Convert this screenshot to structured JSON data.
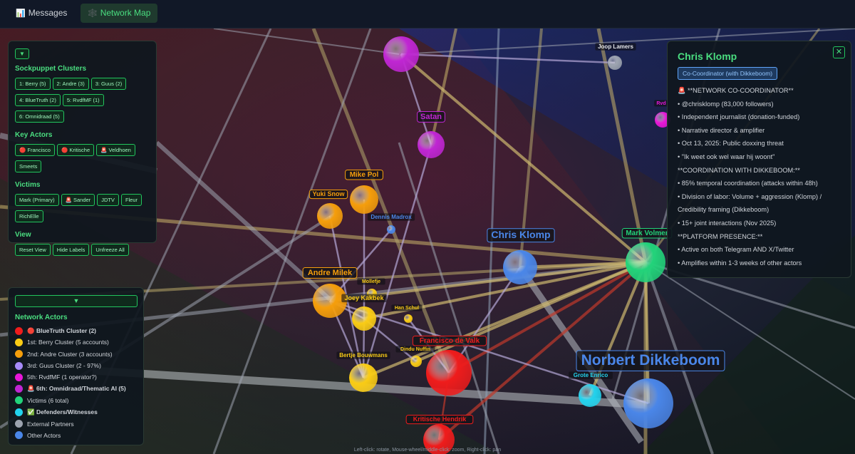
{
  "tabs": [
    {
      "icon": "📊",
      "label": "Messages",
      "active": false
    },
    {
      "icon": "🕸️",
      "label": "Network Map",
      "active": true
    }
  ],
  "controls": {
    "toggle": "▼",
    "sections": [
      {
        "title": "Sockpuppet Clusters",
        "chips": [
          "1: Berry (5)",
          "2: Andre (3)",
          "3: Guus (2)",
          "4: BlueTruth (2)",
          "5: RvdfMF (1)",
          "6: Omnidraad (5)"
        ]
      },
      {
        "title": "Key Actors",
        "chips": [
          "🔴 Francisco",
          "🔴 Kritische",
          "🚨 Veldhoen",
          "Smeets"
        ]
      },
      {
        "title": "Victims",
        "chips": [
          "Mark (Primary)",
          "🚨 Sander",
          "JDTV",
          "Fleur",
          "RichElle"
        ]
      },
      {
        "title": "View",
        "chips": [
          "Reset View",
          "Hide Labels",
          "Unfreeze All"
        ]
      }
    ]
  },
  "legend": {
    "toggle": "▼",
    "title": "Network Actors",
    "items": [
      {
        "label": "🔴 BlueTruth Cluster (2)",
        "color": "#ef1c1c",
        "bold": true
      },
      {
        "label": "1st: Berry Cluster (5 accounts)",
        "color": "#facc15",
        "bold": false
      },
      {
        "label": "2nd: Andre Cluster (3 accounts)",
        "color": "#f59e0b",
        "bold": false
      },
      {
        "label": "3rd: Guus Cluster (2 - 97%)",
        "color": "#a78bfa",
        "bold": false
      },
      {
        "label": "5th: RvdfMF (1 operator?)",
        "color": "#e817d8",
        "bold": false
      },
      {
        "label": "🚨 6th: Omnidraad/Thematic AI (5)",
        "color": "#c026d3",
        "bold": true
      },
      {
        "label": "Victims (6 total)",
        "color": "#22d37a",
        "bold": false
      },
      {
        "label": "✅ Defenders/Witnesses",
        "color": "#22d3ee",
        "bold": true
      },
      {
        "label": "External Partners",
        "color": "#9ca3af",
        "bold": false
      },
      {
        "label": "Other Actors",
        "color": "#4a86e8",
        "bold": false
      }
    ]
  },
  "info": {
    "name": "Chris Klomp",
    "close": "✕",
    "role": "Co-Coordinator (with Dikkeboom)",
    "lines": [
      "🚨 **NETWORK CO-COORDINATOR**",
      "• @chrisklomp (83,000 followers)",
      "• Independent journalist (donation-funded)",
      "• Narrative director & amplifier",
      "• Oct 13, 2025: Public doxxing threat",
      "• \"Ik weet ook wel waar hij woont\"",
      "**COORDINATION WITH DIKKEBOOM:**",
      "• 85% temporal coordination (attacks within 48h)",
      "• Division of labor: Volume + aggression (Klomp) /",
      "Credibility framing (Dikkeboom)",
      "• 15+ joint interactions (Nov 2025)",
      "**PLATFORM PRESENCE:**",
      "• Active on both Telegram AND X/Twitter",
      "• Amplifies within 1-3 weeks of other actors"
    ]
  },
  "graph": {
    "nodes": [
      {
        "id": "omni-top",
        "label": "",
        "color": "#c026d3"
      },
      {
        "id": "satan",
        "label": "Satan",
        "color": "#c026d3"
      },
      {
        "id": "joop",
        "label": "Joop Lamers",
        "color": "#9ca3af"
      },
      {
        "id": "rvd",
        "label": "Rvd",
        "color": "#e817d8"
      },
      {
        "id": "mike",
        "label": "Mike Pol",
        "color": "#f59e0b"
      },
      {
        "id": "yuki",
        "label": "Yuki Snow",
        "color": "#f59e0b"
      },
      {
        "id": "dennis",
        "label": "Dennis Madrox",
        "color": "#4a86e8"
      },
      {
        "id": "chris",
        "label": "Chris Klomp",
        "color": "#4a86e8"
      },
      {
        "id": "mark",
        "label": "Mark Volmer",
        "color": "#22d37a"
      },
      {
        "id": "andre",
        "label": "Andre Milek",
        "color": "#f59e0b"
      },
      {
        "id": "mollefje",
        "label": "Mollefje",
        "color": "#facc15"
      },
      {
        "id": "joey",
        "label": "Joey Kakbek",
        "color": "#facc15"
      },
      {
        "id": "han",
        "label": "Han Schul",
        "color": "#facc15"
      },
      {
        "id": "francisco",
        "label": "Francisco de Valk",
        "color": "#ef1c1c"
      },
      {
        "id": "dindu",
        "label": "Dindu Nuffin",
        "color": "#facc15"
      },
      {
        "id": "bertje",
        "label": "Bertje Bouwmans",
        "color": "#facc15"
      },
      {
        "id": "norbert",
        "label": "Norbert Dikkeboom",
        "color": "#4a86e8"
      },
      {
        "id": "grote",
        "label": "Grote Enrico",
        "color": "#22d3ee"
      },
      {
        "id": "kritische",
        "label": "Kritische Hendrik",
        "color": "#ef1c1c"
      }
    ],
    "edges": [
      [
        "chris",
        "mark"
      ],
      [
        "andre",
        "mark"
      ],
      [
        "francisco",
        "mark"
      ],
      [
        "kritische",
        "mark"
      ],
      [
        "bertje",
        "mark"
      ],
      [
        "joey",
        "mark"
      ],
      [
        "dindu",
        "mark"
      ],
      [
        "norbert",
        "mark"
      ],
      [
        "omni-top",
        "mark"
      ],
      [
        "satan",
        "bertje"
      ],
      [
        "francisco",
        "kritische"
      ],
      [
        "joey",
        "bertje"
      ],
      [
        "andre",
        "joey"
      ],
      [
        "yuki",
        "bertje"
      ],
      [
        "mike",
        "joey"
      ],
      [
        "dennis",
        "andre"
      ],
      [
        "andre",
        "bertje"
      ],
      [
        "joey",
        "dindu"
      ],
      [
        "han",
        "francisco"
      ],
      [
        "norbert",
        "andre"
      ],
      [
        "grote",
        "mark"
      ],
      [
        "chris",
        "francisco"
      ],
      [
        "satan",
        "omni-top"
      ],
      [
        "joop",
        "omni-top"
      ]
    ]
  },
  "hint": "Left-click: rotate, Mouse-wheel/middle-click: zoom, Right-click: pan"
}
